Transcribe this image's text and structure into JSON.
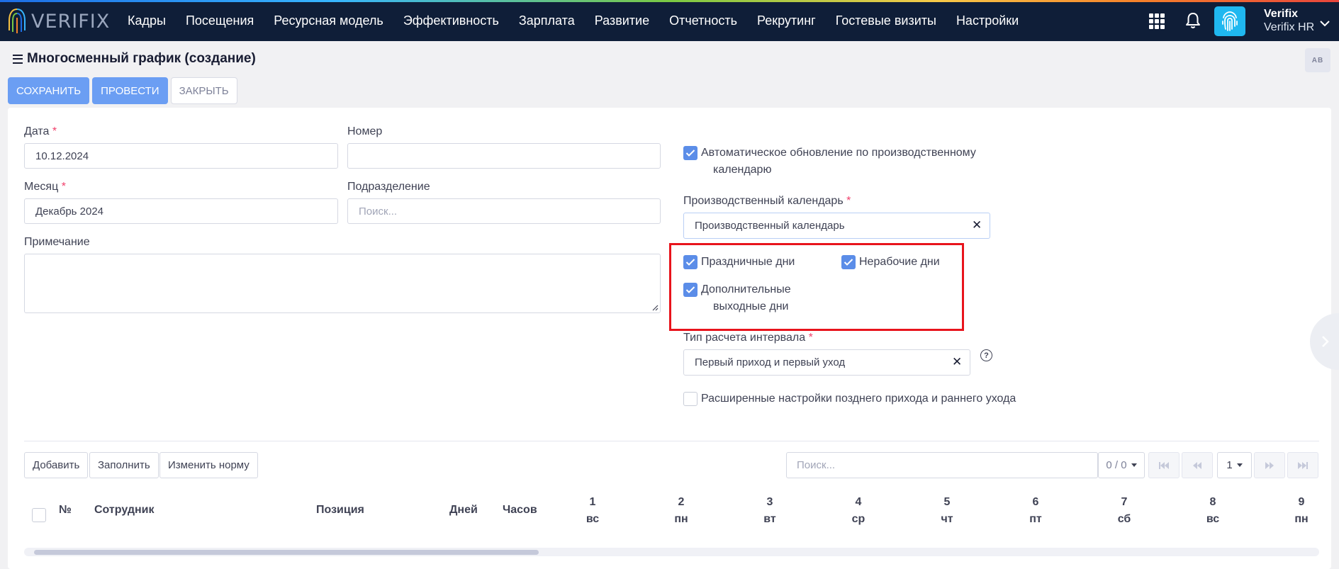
{
  "app": {
    "logo_text": "VERIFIX",
    "nav": [
      "Кадры",
      "Посещения",
      "Ресурсная модель",
      "Эффективность",
      "Зарплата",
      "Развитие",
      "Отчетность",
      "Рекрутинг",
      "Гостевые визиты",
      "Настройки"
    ],
    "user": {
      "name": "Verifix",
      "org": "Verifix HR"
    },
    "icons": {
      "apps": "apps-grid-icon",
      "notifications": "bell-icon",
      "avatar": "fingerprint-icon"
    }
  },
  "page": {
    "title": "Многосменный график (создание)",
    "lang_badge": "AB"
  },
  "toolbar": {
    "save": "СОХРАНИТЬ",
    "post": "ПРОВЕСТИ",
    "close": "ЗАКРЫТЬ"
  },
  "form": {
    "date": {
      "label": "Дата",
      "value": "10.12.2024"
    },
    "number": {
      "label": "Номер",
      "value": ""
    },
    "month": {
      "label": "Месяц",
      "value": "Декабрь 2024"
    },
    "division": {
      "label": "Подразделение",
      "placeholder": "Поиск..."
    },
    "note": {
      "label": "Примечание",
      "value": ""
    },
    "auto_update": {
      "label_line1": "Автоматическое обновление по производственному",
      "label_line2": "календарю",
      "checked": true
    },
    "prod_calendar": {
      "label": "Производственный календарь",
      "value": "Производственный календарь"
    },
    "holidays": {
      "label": "Праздничные дни",
      "checked": true
    },
    "nonworking": {
      "label": "Нерабочие дни",
      "checked": true
    },
    "extra_days_off": {
      "label_line1": "Дополнительные",
      "label_line2": "выходные дни",
      "checked": true
    },
    "interval_type": {
      "label": "Тип расчета интервала",
      "value": "Первый приход и первый уход"
    },
    "advanced_late": {
      "label": "Расширенные настройки позднего прихода и раннего ухода",
      "checked": false
    },
    "required_mark": "*",
    "clear_symbol": "✕",
    "help_symbol": "?"
  },
  "grid": {
    "buttons": {
      "add": "Добавить",
      "fill": "Заполнить",
      "change_norm": "Изменить норму"
    },
    "search_placeholder": "Поиск...",
    "count": "0 / 0",
    "page": "1",
    "columns": {
      "num": "№",
      "employee": "Сотрудник",
      "position": "Позиция",
      "days": "Дней",
      "hours": "Часов"
    },
    "days": [
      {
        "n": "1",
        "wd": "вс"
      },
      {
        "n": "2",
        "wd": "пн"
      },
      {
        "n": "3",
        "wd": "вт"
      },
      {
        "n": "4",
        "wd": "ср"
      },
      {
        "n": "5",
        "wd": "чт"
      },
      {
        "n": "6",
        "wd": "пт"
      },
      {
        "n": "7",
        "wd": "сб"
      },
      {
        "n": "8",
        "wd": "вс"
      },
      {
        "n": "9",
        "wd": "пн"
      }
    ]
  },
  "colors": {
    "primary": "#6b9ef3",
    "nav_bg": "#0f1e38",
    "checkbox": "#5b8de8",
    "highlight": "#e8141c",
    "required": "#f1416c"
  }
}
